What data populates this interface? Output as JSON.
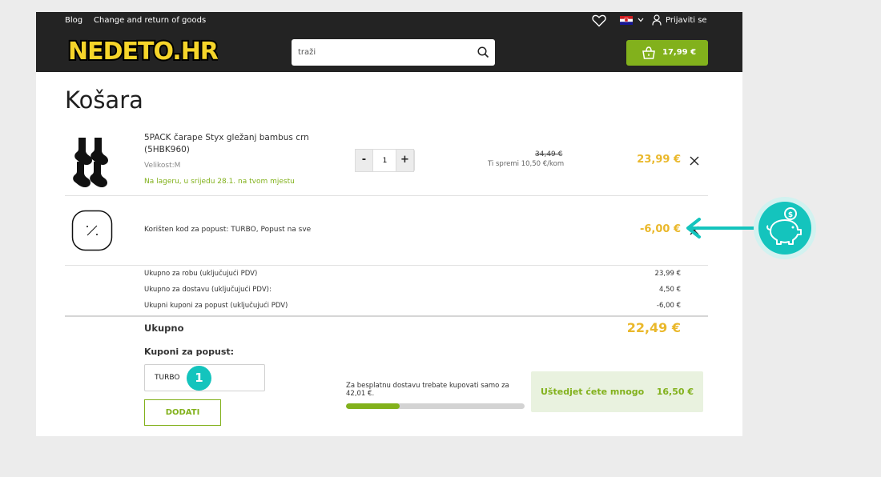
{
  "header": {
    "links": [
      "Blog",
      "Change and return of goods"
    ],
    "logo_text": "NEDETO.HR",
    "login_label": "Prijaviti se",
    "search_placeholder": "traži",
    "cart_amount": "17,99 €"
  },
  "page_title": "Košara",
  "cart_item": {
    "name_line1": "5PACK čarape Styx gležanj bambus crn",
    "name_line2": "(5HBK960)",
    "size": "Velikost:M",
    "stock": "Na lageru, u srijedu 28.1. na tvom mjestu",
    "quantity": "1",
    "minus_label": "-",
    "plus_label": "+",
    "old_price": "34,49 €",
    "saving_note": "Ti spremi 10,50 €/kom",
    "price": "23,99 €"
  },
  "discount_row": {
    "text": "Korišten kod za popust: TURBO, Popust na sve",
    "amount": "-6,00 €"
  },
  "summary": [
    {
      "label": "Ukupno za robu (uključujući PDV)",
      "value": "23,99 €"
    },
    {
      "label": "Ukupno za dostavu (uključujući PDV):",
      "value": "4,50 €"
    },
    {
      "label": "Ukupni kuponi za popust (uključujući PDV)",
      "value": "-6,00 €"
    }
  ],
  "total": {
    "label": "Ukupno",
    "value": "22,49 €"
  },
  "coupon": {
    "heading": "Kuponi za popust:",
    "value": "TURBO",
    "badge": "1",
    "button": "DODATI"
  },
  "shipping": {
    "line1": "Za besplatnu dostavu trebate kupovati samo za",
    "line2": "42,01 €.",
    "progress": 0.3
  },
  "savings": {
    "label": "Uštedjet ćete mnogo",
    "value": "16,50 €"
  },
  "colors": {
    "accent": "#82b11c",
    "price": "#eab82b",
    "teal": "#14c4bd",
    "header": "#232323"
  }
}
